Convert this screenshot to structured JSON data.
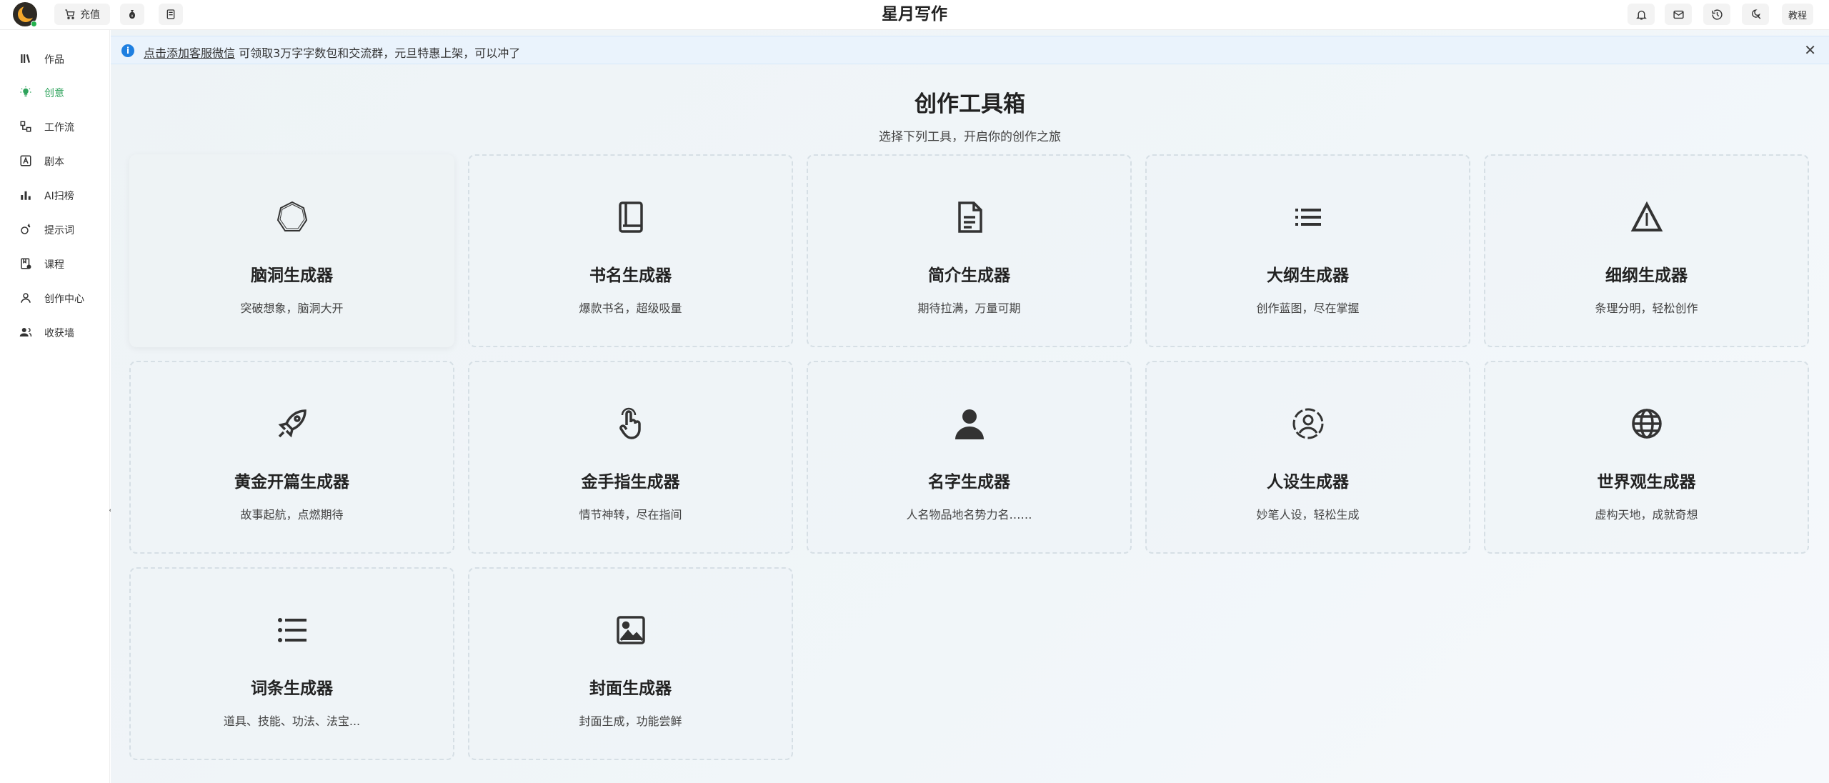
{
  "topbar": {
    "recharge_label": "充值",
    "app_title": "星月写作",
    "tutorial_label": "教程"
  },
  "sidebar": {
    "items": [
      {
        "label": "作品",
        "icon": "books-icon"
      },
      {
        "label": "创意",
        "icon": "lightbulb-icon",
        "active": true
      },
      {
        "label": "工作流",
        "icon": "workflow-icon"
      },
      {
        "label": "剧本",
        "icon": "script-icon"
      },
      {
        "label": "AI扫榜",
        "icon": "bar-chart-icon"
      },
      {
        "label": "提示词",
        "icon": "prompt-icon"
      },
      {
        "label": "课程",
        "icon": "course-icon"
      },
      {
        "label": "创作中心",
        "icon": "user-icon"
      },
      {
        "label": "收获墙",
        "icon": "users-icon"
      }
    ]
  },
  "notice": {
    "link_text": "点击添加客服微信",
    "text": " 可领取3万字字数包和交流群，元旦特惠上架，可以冲了"
  },
  "main": {
    "title": "创作工具箱",
    "subtitle": "选择下列工具，开启你的创作之旅"
  },
  "tools": [
    {
      "name": "脑洞生成器",
      "desc": "突破想象，脑洞大开",
      "icon": "hexagon-icon"
    },
    {
      "name": "书名生成器",
      "desc": "爆款书名，超级吸量",
      "icon": "book-icon"
    },
    {
      "name": "简介生成器",
      "desc": "期待拉满，万量可期",
      "icon": "document-icon"
    },
    {
      "name": "大纲生成器",
      "desc": "创作蓝图，尽在掌握",
      "icon": "list-icon"
    },
    {
      "name": "细纲生成器",
      "desc": "条理分明，轻松创作",
      "icon": "triangle-icon"
    },
    {
      "name": "黄金开篇生成器",
      "desc": "故事起航，点燃期待",
      "icon": "rocket-icon"
    },
    {
      "name": "金手指生成器",
      "desc": "情节神转，尽在指间",
      "icon": "pointer-icon"
    },
    {
      "name": "名字生成器",
      "desc": "人名物品地名势力名……",
      "icon": "person-icon"
    },
    {
      "name": "人设生成器",
      "desc": "妙笔人设，轻松生成",
      "icon": "user-circle-icon"
    },
    {
      "name": "世界观生成器",
      "desc": "虚构天地，成就奇想",
      "icon": "globe-icon"
    },
    {
      "name": "词条生成器",
      "desc": "道具、技能、功法、法宝...",
      "icon": "bullet-list-icon"
    },
    {
      "name": "封面生成器",
      "desc": "封面生成，功能尝鲜",
      "icon": "image-icon"
    }
  ]
}
